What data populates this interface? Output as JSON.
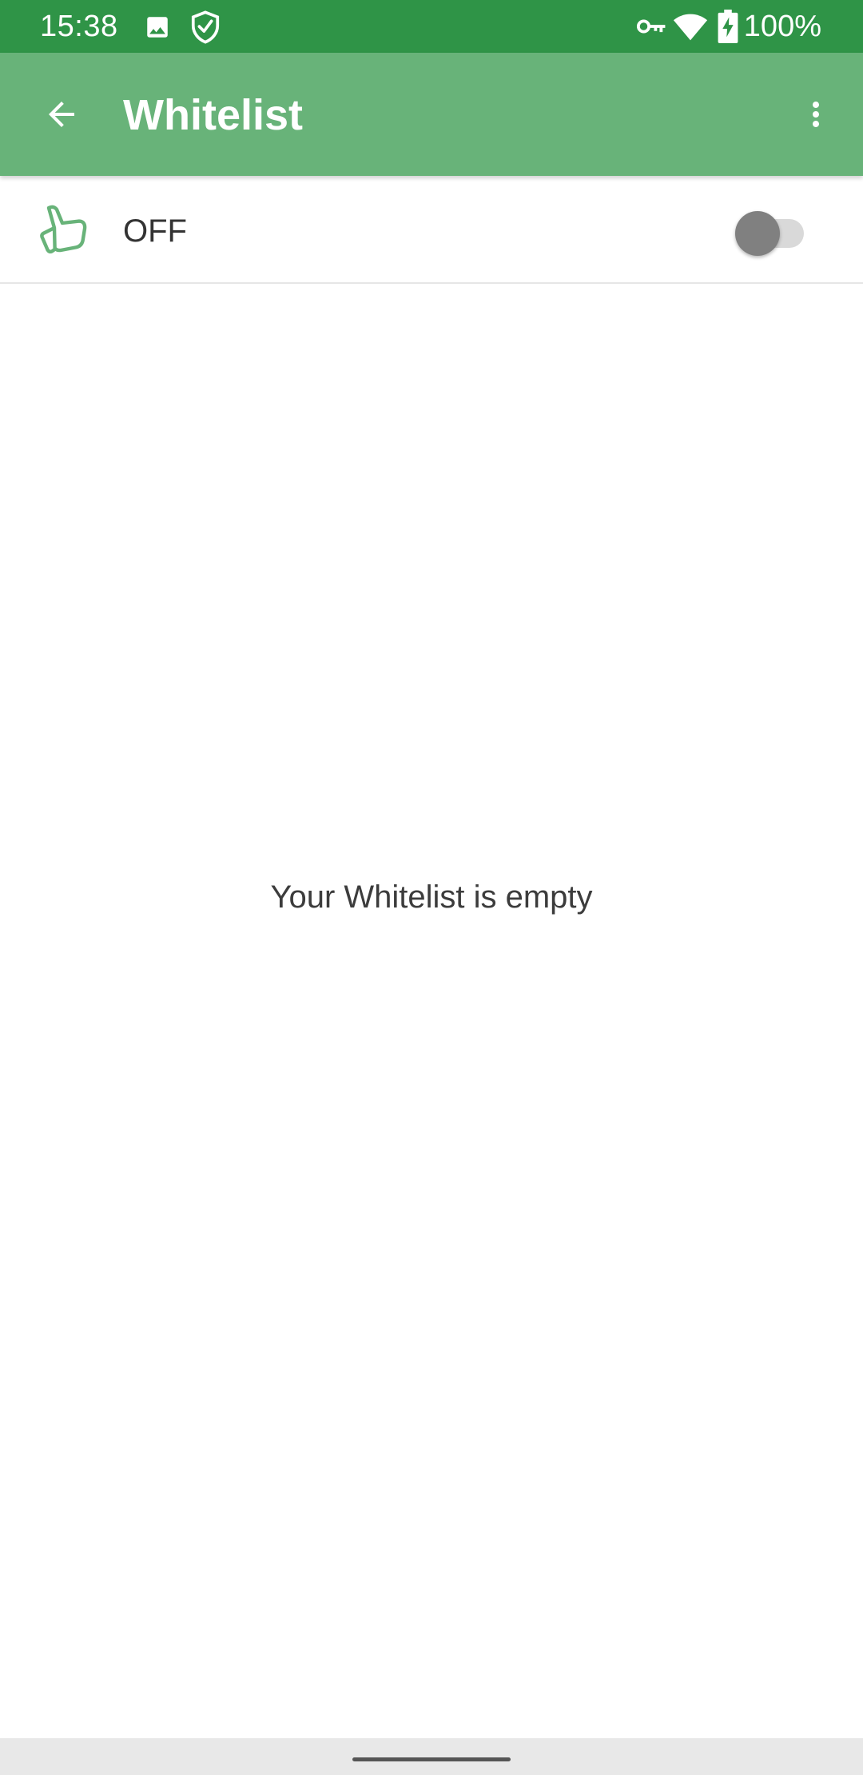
{
  "status_bar": {
    "time": "15:38",
    "battery": "100%",
    "icons": [
      "image-icon",
      "shield-check-icon",
      "vpn-key-icon",
      "wifi-icon",
      "battery-charging-icon"
    ]
  },
  "app_bar": {
    "title": "Whitelist",
    "back_icon": "arrow-back-icon",
    "menu_icon": "more-vert-icon"
  },
  "toggle_row": {
    "icon": "thumbs-up-icon",
    "label": "OFF",
    "enabled": false
  },
  "empty_state": {
    "message": "Your Whitelist is empty"
  },
  "colors": {
    "status_bar": "#2f9447",
    "app_bar": "#68b379",
    "accent_icon": "#68b379",
    "switch_track_off": "#d9d9d9",
    "switch_knob_off": "#808080"
  }
}
